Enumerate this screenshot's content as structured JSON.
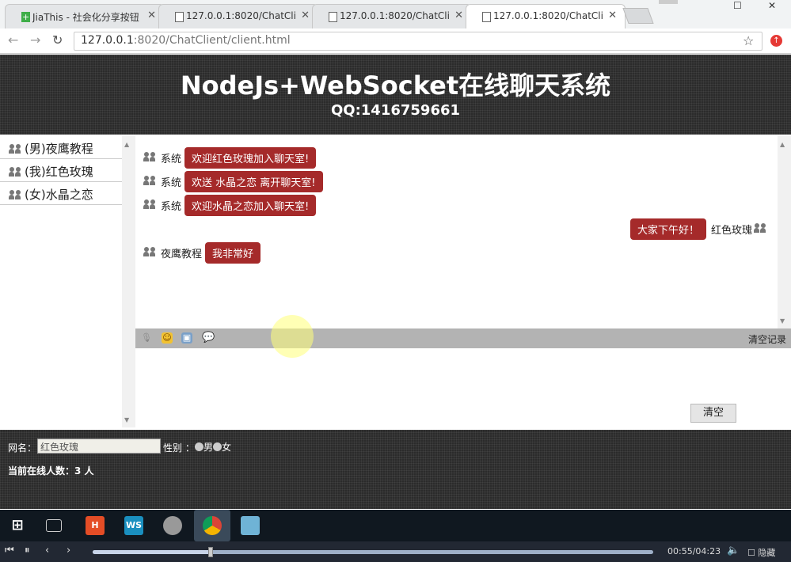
{
  "browser": {
    "tabs": [
      {
        "label": "JiaThis - 社会化分享按钮",
        "icon": "plus-icon"
      },
      {
        "label": "127.0.0.1:8020/ChatCli",
        "icon": "page-icon"
      },
      {
        "label": "127.0.0.1:8020/ChatCli",
        "icon": "page-icon"
      },
      {
        "label": "127.0.0.1:8020/ChatCli",
        "icon": "page-icon"
      }
    ],
    "url_host": "127.0.0.1",
    "url_path": ":8020/ChatClient/client.html"
  },
  "header": {
    "title": "NodeJs+WebSocket在线聊天系统",
    "subtitle": "QQ:1416759661"
  },
  "users": [
    "(男)夜鹰教程",
    "(我)红色玫瑰",
    "(女)水晶之恋"
  ],
  "messages": [
    {
      "sender": "系统",
      "text": "欢迎红色玫瑰加入聊天室!",
      "side": "left"
    },
    {
      "sender": "系统",
      "text": "欢送 水晶之恋 离开聊天室!",
      "side": "left"
    },
    {
      "sender": "系统",
      "text": "欢迎水晶之恋加入聊天室!",
      "side": "left"
    },
    {
      "sender": "红色玫瑰",
      "text": "大家下午好！",
      "side": "right"
    },
    {
      "sender": "夜鹰教程",
      "text": "我非常好",
      "side": "left"
    }
  ],
  "toolbar": {
    "tools": [
      "mic-icon",
      "emoji-icon",
      "image-icon",
      "chat-bubble-icon"
    ],
    "clear_records": "清空记录"
  },
  "buttons": {
    "clear": "清空"
  },
  "footer": {
    "nickname_label": "网名：",
    "nickname_value": "红色玫瑰",
    "gender_label": "性别 ：",
    "gender_male": "男",
    "gender_female": "女",
    "online_count": "当前在线人数：3 人"
  },
  "player": {
    "time": "00:55/04:23",
    "hide_label": "隐藏",
    "progress": 0.21
  },
  "colors": {
    "bubble": "#a52a2a",
    "header_bg": "#2b2b2b"
  }
}
